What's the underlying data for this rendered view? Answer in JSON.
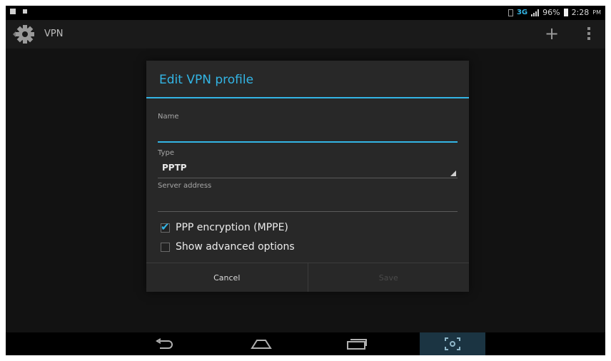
{
  "status_bar": {
    "network": "3G",
    "battery": "96%",
    "time": "2:28",
    "ampm": "PM"
  },
  "action_bar": {
    "title": "VPN",
    "icons": {
      "app": "settings-gear-icon",
      "add": "plus-icon",
      "overflow": "overflow-menu-icon"
    }
  },
  "dialog": {
    "title": "Edit VPN profile",
    "name": {
      "label": "Name",
      "value": ""
    },
    "type": {
      "label": "Type",
      "selected": "PPTP"
    },
    "server_address": {
      "label": "Server address",
      "value": ""
    },
    "ppp_encryption": {
      "label": "PPP encryption (MPPE)",
      "checked": true
    },
    "show_advanced": {
      "label": "Show advanced options",
      "checked": false
    },
    "cancel_label": "Cancel",
    "save_label": "Save"
  },
  "nav_bar": {
    "icons": [
      "back-icon",
      "home-icon",
      "recents-icon",
      "screenshot-icon"
    ]
  },
  "colors": {
    "accent": "#33b5e5",
    "background": "#121212",
    "dialog": "#282828"
  }
}
